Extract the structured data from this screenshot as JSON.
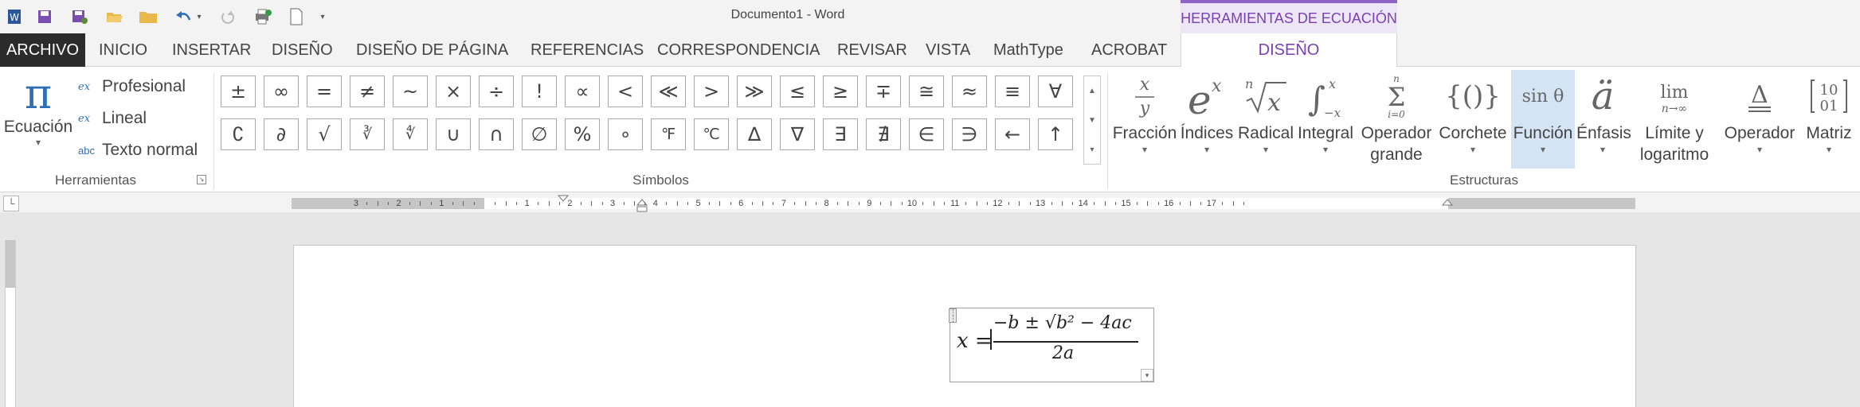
{
  "titlebar": {
    "doc_title": "Documento1 - Word",
    "context_tab_group": "HERRAMIENTAS DE ECUACIÓN",
    "quick_access": [
      "word-app-icon",
      "save-icon",
      "save-as-icon",
      "open-folder-icon",
      "folder-icon",
      "undo-icon",
      "undo-dropdown-icon",
      "redo-icon",
      "print-preview-icon",
      "new-document-icon",
      "customize-toolbar-icon"
    ]
  },
  "tabs": {
    "archivo": "ARCHIVO",
    "inicio": "INICIO",
    "insertar": "INSERTAR",
    "diseno": "DISEÑO",
    "diseno_pagina": "DISEÑO DE PÁGINA",
    "referencias": "REFERENCIAS",
    "correspondencia": "CORRESPONDENCIA",
    "revisar": "REVISAR",
    "vista": "VISTA",
    "mathtype": "MathType",
    "acrobat": "ACROBAT",
    "diseno_ecuacion": "DISEÑO"
  },
  "herramientas": {
    "group_label": "Herramientas",
    "ecuacion": "Ecuación",
    "ecuacion_icon": "π",
    "profesional": "Profesional",
    "lineal": "Lineal",
    "texto_normal": "Texto normal",
    "texto_normal_icon": "abc"
  },
  "simbolos": {
    "group_label": "Símbolos",
    "row1": [
      "±",
      "∞",
      "=",
      "≠",
      "~",
      "×",
      "÷",
      "!",
      "∝",
      "<",
      "≪",
      ">",
      "≫",
      "≤",
      "≥",
      "∓",
      "≅",
      "≈",
      "≡",
      "∀"
    ],
    "row2": [
      "∁",
      "∂",
      "√",
      "∛",
      "∜",
      "∪",
      "∩",
      "∅",
      "%",
      "∘",
      "℉",
      "℃",
      "∆",
      "∇",
      "∃",
      "∄",
      "∈",
      "∋",
      "←",
      "↑"
    ]
  },
  "estructuras": {
    "group_label": "Estructuras",
    "buttons": [
      {
        "label": "Fracción",
        "label2": "",
        "icon": "x/y"
      },
      {
        "label": "Índices",
        "label2": "",
        "icon": "eˣ"
      },
      {
        "label": "Radical",
        "label2": "",
        "icon": "ⁿ√x"
      },
      {
        "label": "Integral",
        "label2": "",
        "icon": "∫"
      },
      {
        "label": "Operador",
        "label2": "grande",
        "icon": "Σ"
      },
      {
        "label": "Corchete",
        "label2": "",
        "icon": "{()}"
      },
      {
        "label": "Función",
        "label2": "",
        "icon": "sin θ"
      },
      {
        "label": "Énfasis",
        "label2": "",
        "icon": "ä"
      },
      {
        "label": "Límite y",
        "label2": "logaritmo",
        "icon": "lim"
      },
      {
        "label": "Operador",
        "label2": "",
        "icon": "Δ"
      },
      {
        "label": "Matriz",
        "label2": "",
        "icon": "[10;01]"
      }
    ]
  },
  "ruler": {
    "left_numbers": [
      "3",
      "2",
      "1"
    ],
    "right_numbers": [
      "1",
      "2",
      "3",
      "4",
      "5",
      "6",
      "7",
      "8",
      "9",
      "10",
      "11",
      "12",
      "13",
      "14",
      "15",
      "16",
      "17"
    ]
  },
  "equation": {
    "lhs": "x =",
    "numerator": "−b ± √b² − 4ac",
    "denominator": "2a"
  }
}
